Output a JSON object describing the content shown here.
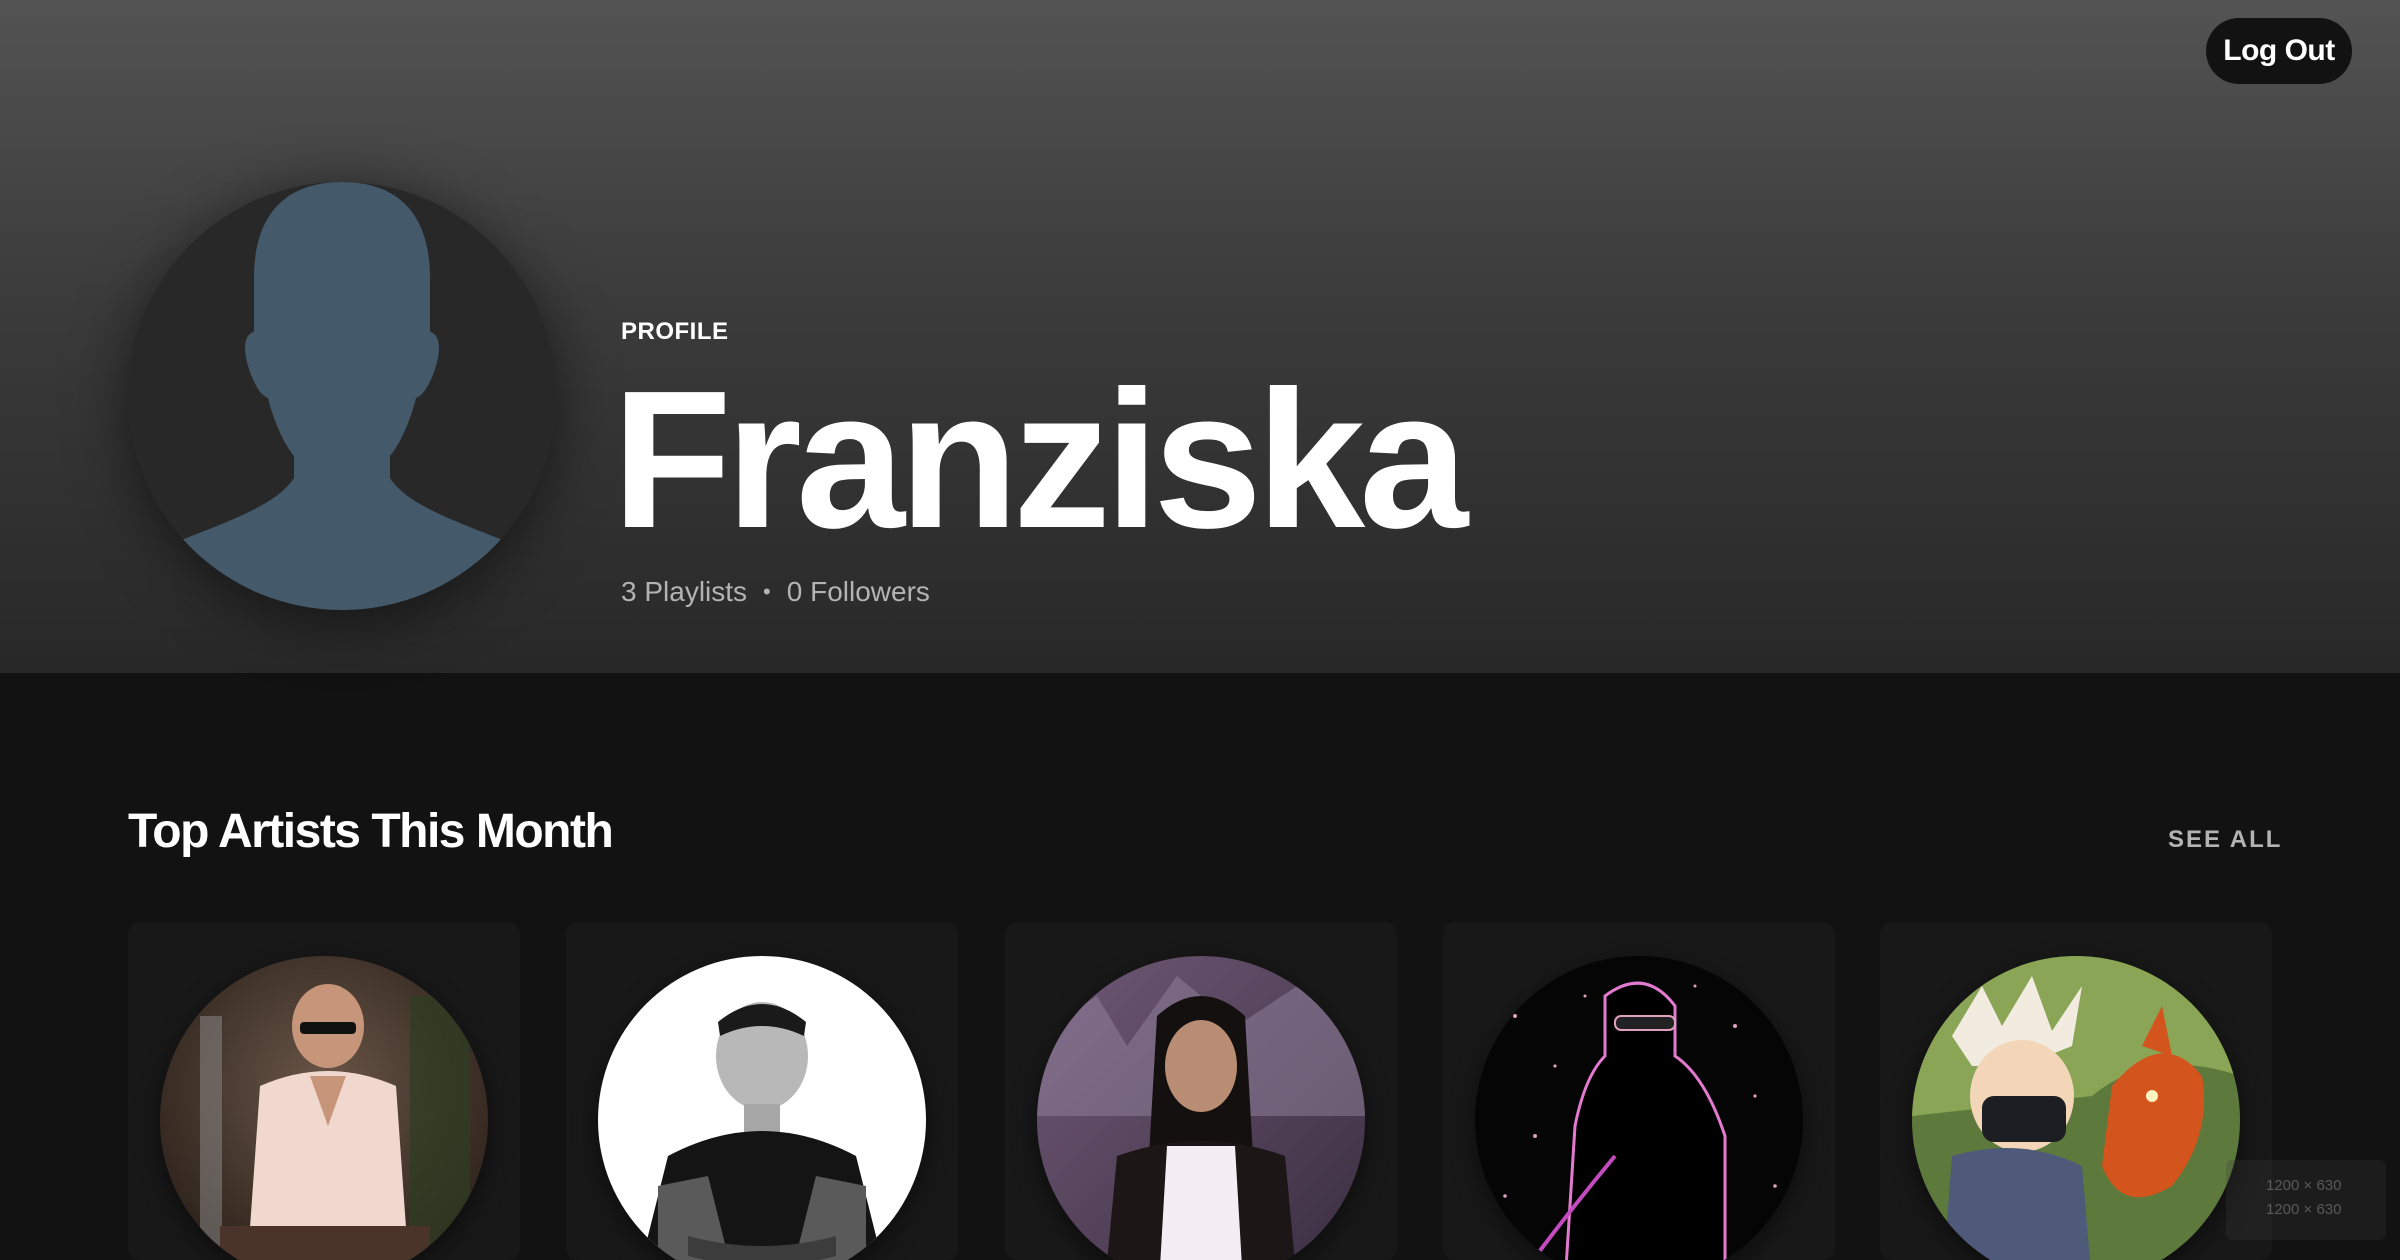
{
  "header": {
    "logout_label": "Log Out"
  },
  "profile": {
    "kicker": "PROFILE",
    "name": "Franziska",
    "playlists": "3 Playlists",
    "separator": "•",
    "followers": "0 Followers",
    "avatar_icon": "user-silhouette-icon"
  },
  "top_artists": {
    "title": "Top Artists This Month",
    "see_all_label": "SEE ALL",
    "artists": [
      {
        "image": "artist-photo-1"
      },
      {
        "image": "artist-photo-2"
      },
      {
        "image": "artist-photo-3"
      },
      {
        "image": "artist-photo-4"
      },
      {
        "image": "artist-photo-5"
      }
    ]
  },
  "overlay": {
    "viewport_size": "1200 × 630",
    "window_size": "1200 × 630"
  },
  "colors": {
    "page_bg": "#121212",
    "card_bg": "#181818",
    "avatar_figure": "#44596a",
    "secondary_text": "#b3b3b3"
  }
}
